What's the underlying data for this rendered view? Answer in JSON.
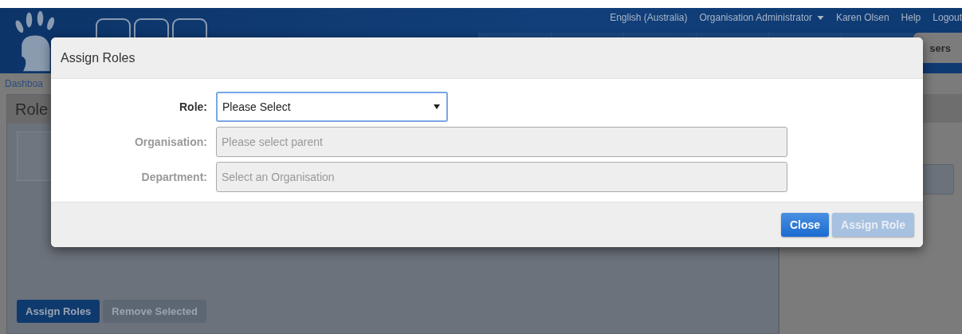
{
  "header": {
    "top_links": [
      {
        "label": "English (Australia)",
        "dropdown": false
      },
      {
        "label": "Organisation Administrator",
        "dropdown": true
      },
      {
        "label": "Karen Olsen",
        "dropdown": false
      },
      {
        "label": "Help",
        "dropdown": false
      },
      {
        "label": "Logout",
        "dropdown": false
      }
    ],
    "nav_tabs": [
      {
        "label": "sers",
        "selected": true
      }
    ]
  },
  "breadcrumb": "Dashboa",
  "panel_title": "Role",
  "page_buttons": [
    {
      "label": "Assign Roles",
      "disabled": false
    },
    {
      "label": "Remove Selected",
      "disabled": true
    }
  ],
  "modal": {
    "title": "Assign Roles",
    "fields": [
      {
        "label": "Role:",
        "kind": "select",
        "value": "Please Select",
        "disabled": false,
        "focused": true
      },
      {
        "label": "Organisation:",
        "kind": "input",
        "placeholder": "Please select parent",
        "disabled": true,
        "focused": false
      },
      {
        "label": "Department:",
        "kind": "input",
        "placeholder": "Select an Organisation",
        "disabled": true,
        "focused": false
      }
    ],
    "buttons": [
      {
        "label": "Close",
        "disabled": false
      },
      {
        "label": "Assign Role",
        "disabled": true
      }
    ]
  }
}
